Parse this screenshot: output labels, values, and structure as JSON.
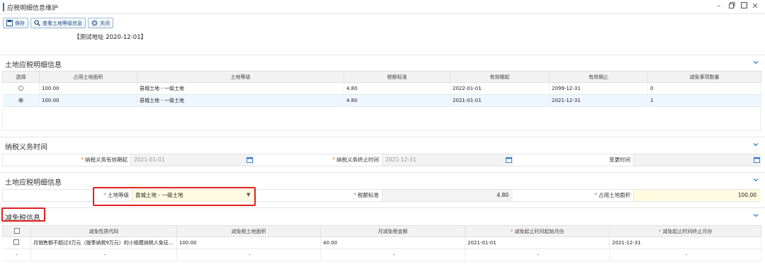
{
  "window": {
    "title": "应税明细信息维护"
  },
  "toolbar": {
    "save_label": "保存",
    "view_land_label": "查看土地等级信息",
    "close_label": "关闭"
  },
  "test_address": "【测试地址 2020-12-01】",
  "section1": {
    "title": "土地应税明细信息",
    "columns": [
      "选择",
      "占用土地面积",
      "土地等级",
      "税额标准",
      "有效期起",
      "有效期止",
      "减免事项数量"
    ],
    "rows": [
      {
        "selected": false,
        "area": "100.00",
        "grade": "县城土地 - 一级土地",
        "rate": "4.80",
        "start": "2022-01-01",
        "end": "2099-12-31",
        "count": "0"
      },
      {
        "selected": true,
        "area": "100.00",
        "grade": "县城土地 - 一级土地",
        "rate": "4.80",
        "start": "2021-01-01",
        "end": "2021-12-31",
        "count": "1"
      }
    ]
  },
  "section2": {
    "title": "纳税义务时间",
    "start_label": "纳税义务有效期起",
    "start_value": "2021-01-01",
    "end_label": "纳税义务终止时间",
    "end_value": "2021-12-31",
    "change_label": "变更时间",
    "change_value": ""
  },
  "section3": {
    "title": "土地应税明细信息",
    "grade_label": "土地等级",
    "grade_value": "县城土地 - 一级土地",
    "rate_label": "税额标准",
    "rate_value": "4.80",
    "area_label": "占用土地面积",
    "area_value": "100.00"
  },
  "section4": {
    "title": "减免税信息",
    "columns": [
      "减免性质代码",
      "减免税土地面积",
      "月减免税金额",
      "减免起止时间起始月份",
      "减免起止时间终止月份"
    ],
    "rows": [
      {
        "code": "月销售额不超过3万元（按季纳税9万元）的小规模纳税人免征...",
        "area": "100.00",
        "amount": "40.00",
        "start": "2021-01-01",
        "end": "2021-12-31"
      },
      {
        "code": "-",
        "area": "-",
        "amount": "-",
        "start": "-",
        "end": "-"
      }
    ]
  },
  "colors": {
    "accent": "#1a73c8",
    "required": "#e8771b",
    "highlight": "#e0201e"
  }
}
